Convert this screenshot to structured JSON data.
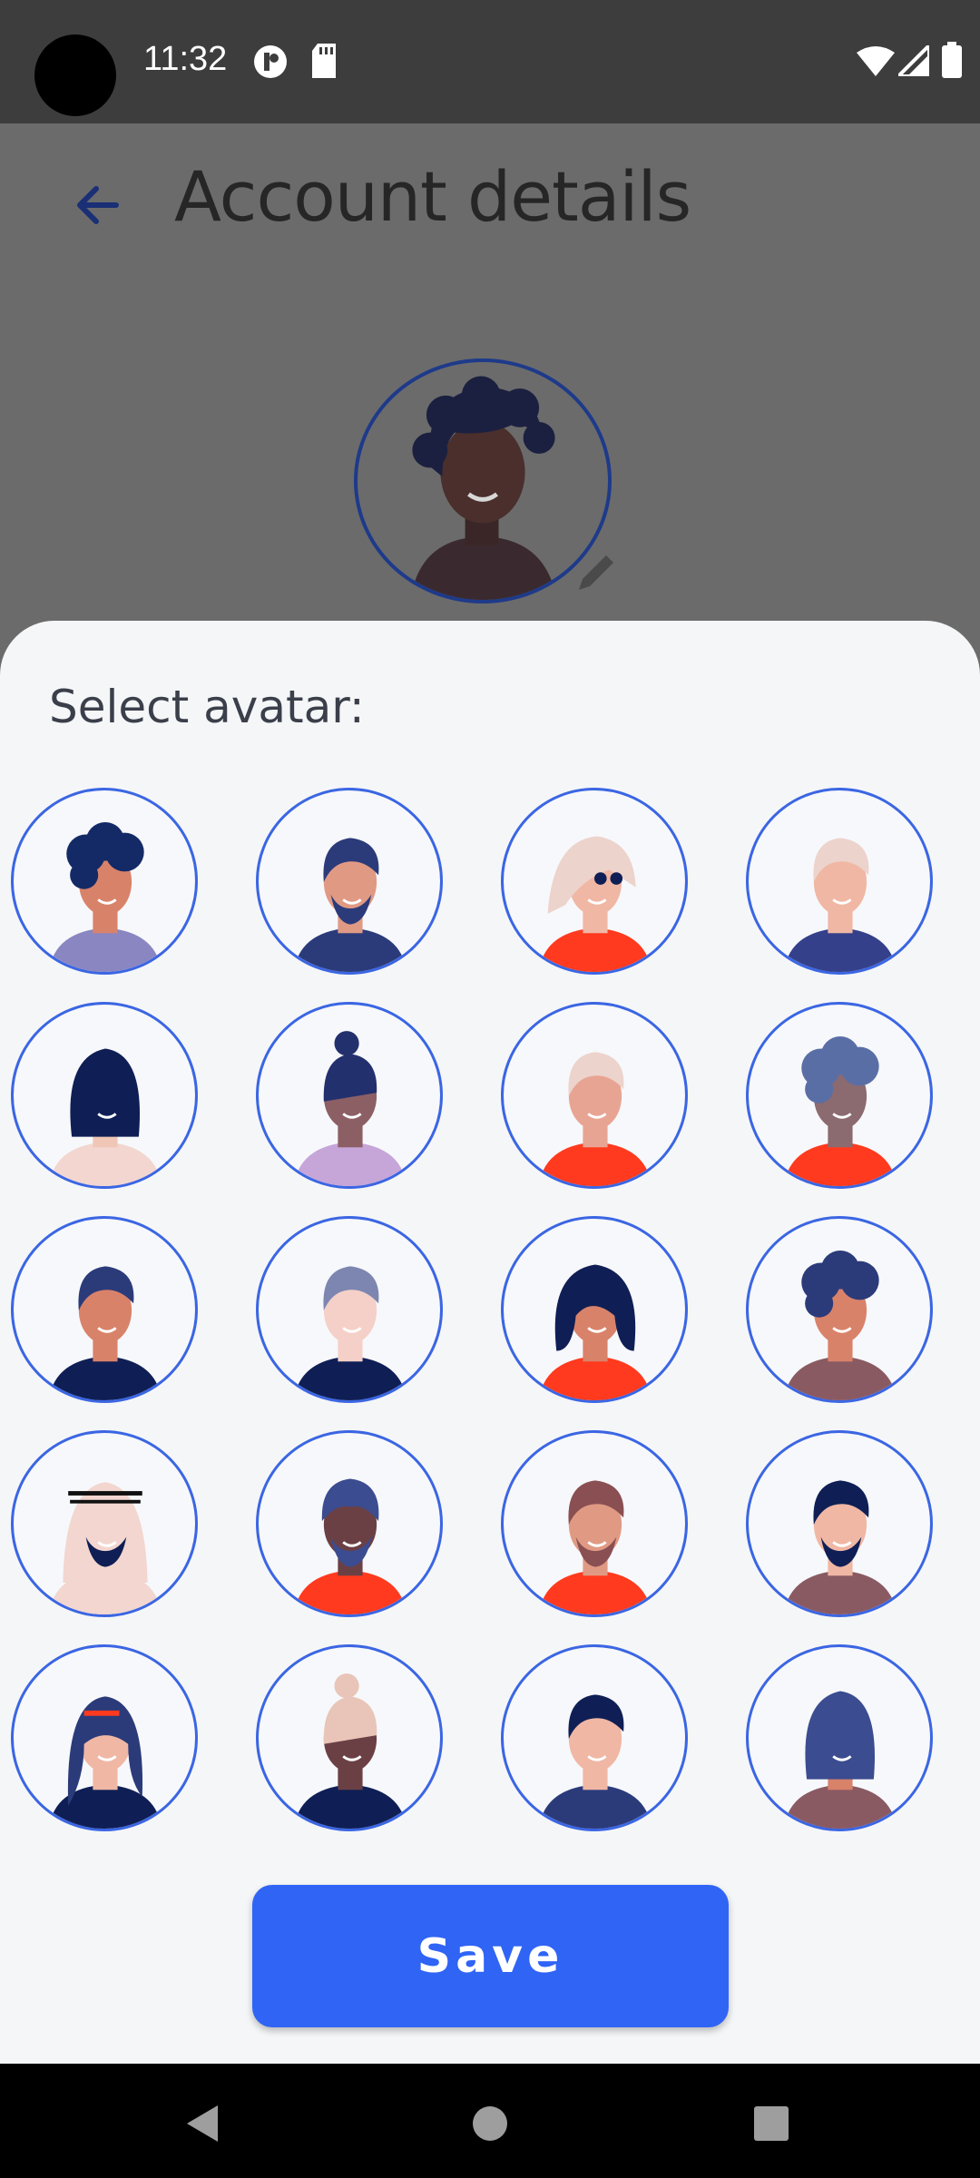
{
  "status_bar": {
    "time": "11:32",
    "icons": [
      "app-notification-icon",
      "sd-card-icon",
      "wifi-icon",
      "cellular-signal-icon",
      "battery-icon"
    ]
  },
  "header": {
    "title": "Account details",
    "back_icon": "arrow-left-icon"
  },
  "profile": {
    "edit_icon": "pencil-icon"
  },
  "sheet": {
    "title": "Select avatar:",
    "save_label": "Save"
  },
  "colors": {
    "accent": "#2f64f5",
    "avatar_border": "#3b66e3",
    "sheet_bg": "#f5f6f8",
    "dim_overlay": "#6b6b6b"
  },
  "avatars": [
    {
      "skin": "#d9826a",
      "hair": "#142a66",
      "shirt": "#8a86c2",
      "style": "curly"
    },
    {
      "skin": "#e09a84",
      "hair": "#2b3b7a",
      "shirt": "#2b3b7a",
      "style": "beard"
    },
    {
      "skin": "#f0b7a4",
      "hair": "#ecd3cc",
      "shirt": "#ff3a1e",
      "style": "long-glasses"
    },
    {
      "skin": "#f0b7a4",
      "hair": "#ecd3cc",
      "shirt": "#34408a",
      "style": "short"
    },
    {
      "skin": "#f0c6b6",
      "hair": "#0f1f55",
      "shirt": "#f2d6cf",
      "style": "long"
    },
    {
      "skin": "#8c5f65",
      "hair": "#23306e",
      "shirt": "#c6a5d8",
      "style": "bun"
    },
    {
      "skin": "#e8a492",
      "hair": "#ecd3cc",
      "shirt": "#ff3a1e",
      "style": "short"
    },
    {
      "skin": "#8b6a70",
      "hair": "#5a6ea6",
      "shirt": "#ff3a1e",
      "style": "afro"
    },
    {
      "skin": "#d9826a",
      "hair": "#2b3b7a",
      "shirt": "#0f1f55",
      "style": "short"
    },
    {
      "skin": "#f4d0c8",
      "hair": "#7c86b0",
      "shirt": "#0f1f55",
      "style": "short"
    },
    {
      "skin": "#d9826a",
      "hair": "#0f1f55",
      "shirt": "#ff3a1e",
      "style": "bob"
    },
    {
      "skin": "#d9826a",
      "hair": "#2b3b7a",
      "shirt": "#8a5a63",
      "style": "curly"
    },
    {
      "skin": "#f2c4b4",
      "hair": "#f2d6cf",
      "shirt": "#f2d6cf",
      "style": "headdress"
    },
    {
      "skin": "#6b4045",
      "hair": "#3b4c90",
      "shirt": "#ff3a1e",
      "style": "turban"
    },
    {
      "skin": "#e09a84",
      "hair": "#8a4f52",
      "shirt": "#ff3a1e",
      "style": "beard"
    },
    {
      "skin": "#f0b7a4",
      "hair": "#0f1f55",
      "shirt": "#8a5a63",
      "style": "beard"
    },
    {
      "skin": "#f0b7a4",
      "hair": "#2b3b7a",
      "shirt": "#0f1f55",
      "style": "hijab"
    },
    {
      "skin": "#6b4045",
      "hair": "#e8c5b8",
      "shirt": "#0f1f55",
      "style": "bun"
    },
    {
      "skin": "#f0b7a4",
      "hair": "#0f1f55",
      "shirt": "#2b3b7a",
      "style": "short"
    },
    {
      "skin": "#d9826a",
      "hair": "#3b4c90",
      "shirt": "#8a5a63",
      "style": "long"
    }
  ],
  "nav": {
    "back_icon": "triangle-back-icon",
    "home_icon": "circle-home-icon",
    "recents_icon": "square-recents-icon"
  }
}
